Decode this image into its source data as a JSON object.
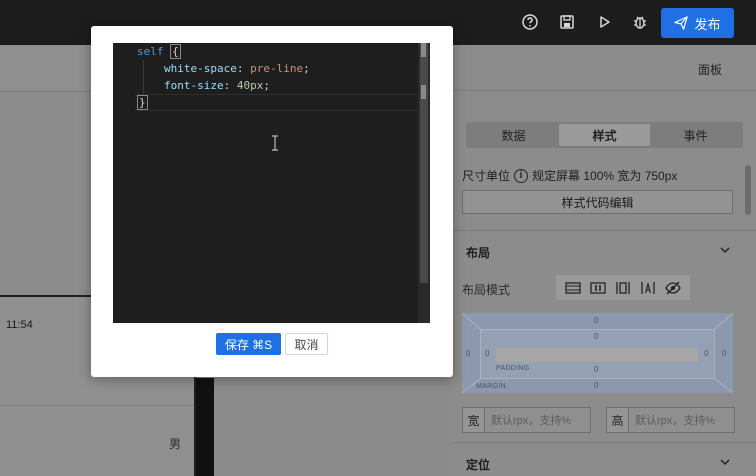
{
  "topbar": {
    "publish_label": "发布",
    "icons": [
      "help-icon",
      "save-icon",
      "play-icon",
      "bug-icon",
      "send-icon"
    ]
  },
  "right_panel": {
    "panel_label": "面板",
    "tabs": [
      {
        "label": "数据",
        "active": false
      },
      {
        "label": "样式",
        "active": true
      },
      {
        "label": "事件",
        "active": false
      }
    ],
    "unit_label": "尺寸单位",
    "unit_value": "规定屏幕 100% 宽为 750px",
    "code_button": "样式代码编辑",
    "layout_section": "布局",
    "layout_mode_label": "布局模式",
    "box_model": {
      "margin_label": "MARGIN",
      "padding_label": "PADDING",
      "values": [
        "0",
        "0",
        "0",
        "0",
        "0",
        "0",
        "0",
        "0"
      ]
    },
    "width_label": "宽",
    "width_placeholder": "默认rpx，支持%",
    "height_label": "高",
    "height_placeholder": "默认rpx，支持%",
    "position_section": "定位"
  },
  "phone": {
    "time": "11:54",
    "gender": "男"
  },
  "modal": {
    "code": {
      "selector": "self",
      "prop1": "white-space",
      "val1": "pre-line",
      "prop2": "font-size",
      "val2": "40px"
    },
    "save_label": "保存 ⌘S",
    "cancel_label": "取消"
  },
  "colors": {
    "accent": "#1f6fe5",
    "editor_bg": "#1e1e1e",
    "topbar_bg": "#1c1c1c"
  }
}
